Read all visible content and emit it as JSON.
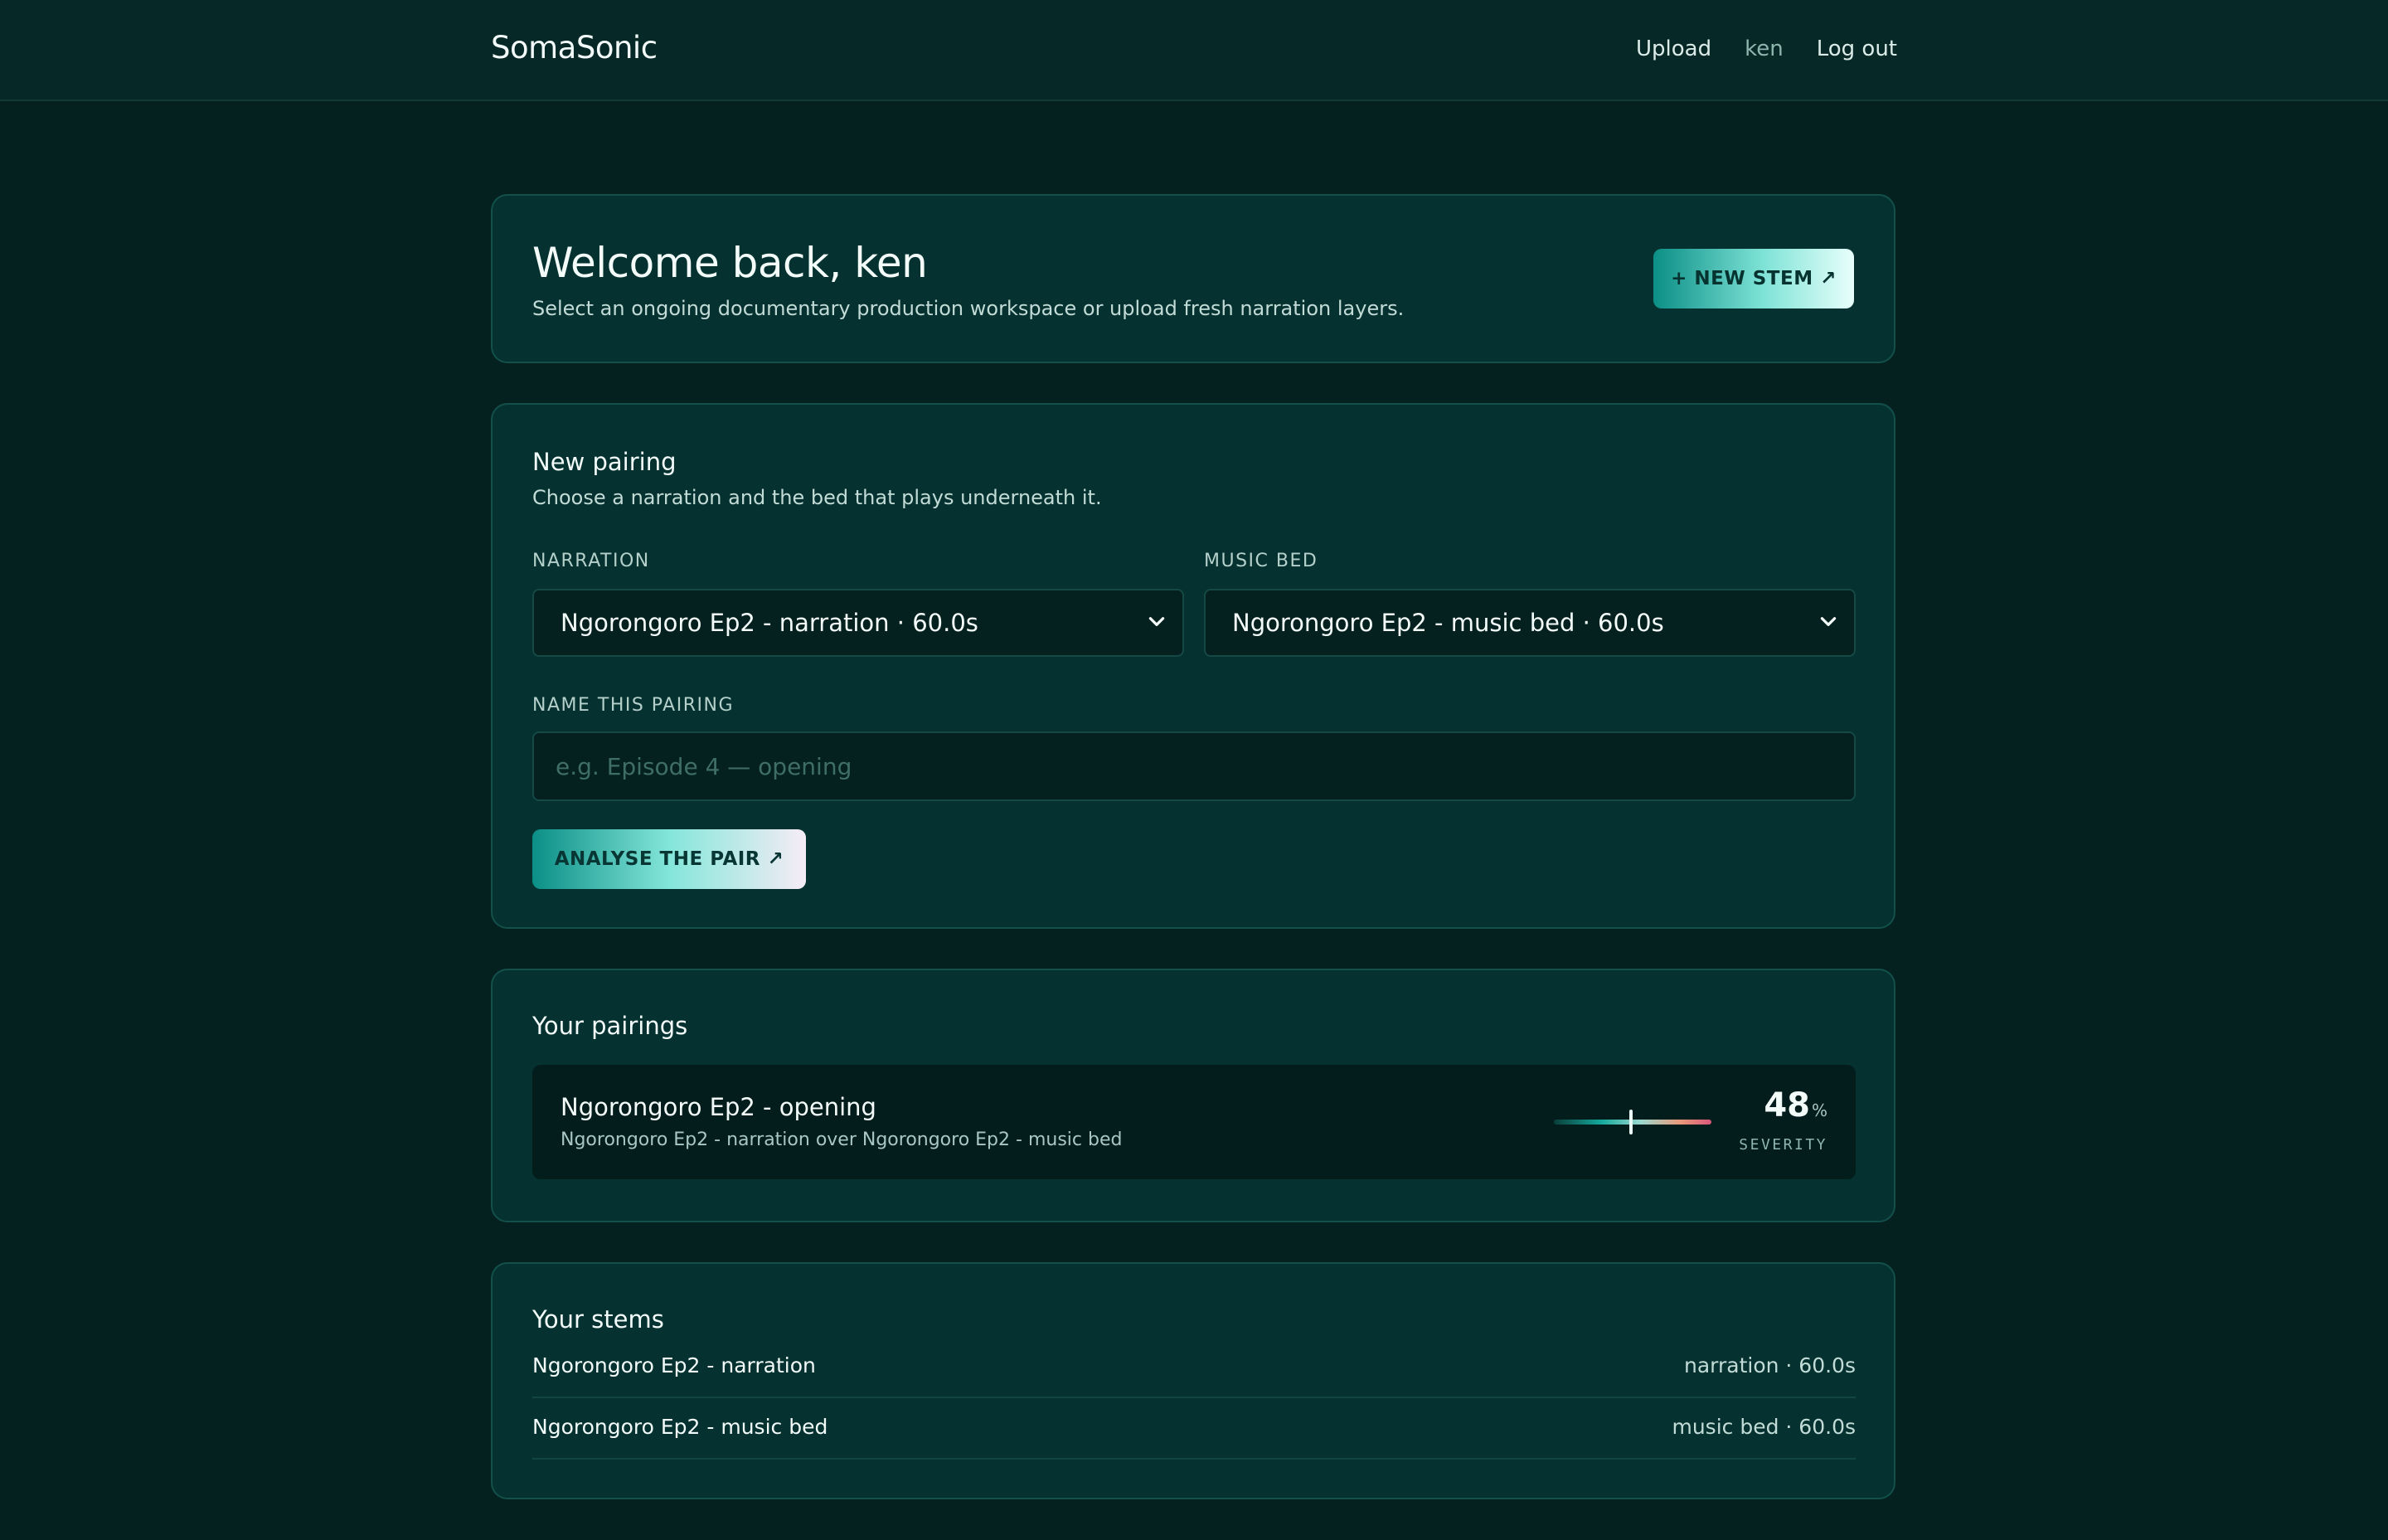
{
  "header": {
    "brand": "SomaSonic",
    "nav": {
      "upload": "Upload",
      "user": "ken",
      "logout": "Log out"
    }
  },
  "welcome": {
    "title": "Welcome back, ken",
    "subtitle": "Select an ongoing documentary production workspace or upload fresh narration layers.",
    "new_stem_button": "+ NEW STEM ↗"
  },
  "new_pairing": {
    "title": "New pairing",
    "subtitle": "Choose a narration and the bed that plays underneath it.",
    "narration_label": "NARRATION",
    "narration_value": "Ngorongoro Ep2 - narration · 60.0s",
    "music_bed_label": "MUSIC BED",
    "music_bed_value": "Ngorongoro Ep2 - music bed · 60.0s",
    "name_label": "NAME THIS PAIRING",
    "name_placeholder": "e.g. Episode 4 — opening",
    "analyse_button": "ANALYSE THE PAIR ↗"
  },
  "pairings": {
    "title": "Your pairings",
    "items": [
      {
        "name": "Ngorongoro Ep2 - opening",
        "detail": "Ngorongoro Ep2 - narration over Ngorongoro Ep2 - music bed",
        "severity": "48",
        "severity_unit": "%",
        "severity_label": "SEVERITY"
      }
    ]
  },
  "stems": {
    "title": "Your stems",
    "items": [
      {
        "name": "Ngorongoro Ep2 - narration",
        "meta": "narration · 60.0s"
      },
      {
        "name": "Ngorongoro Ep2 - music bed",
        "meta": "music bed · 60.0s"
      }
    ]
  },
  "colors": {
    "background": "#04201f",
    "card": "#053230",
    "accent": "#0b8f86"
  }
}
